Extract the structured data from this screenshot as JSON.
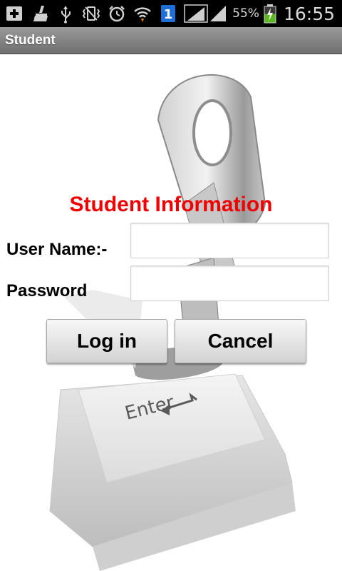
{
  "status_bar": {
    "icons": [
      "add-notification-icon",
      "broom-icon",
      "usb-icon",
      "vibrate-icon",
      "alarm-icon",
      "wifi-icon",
      "sim-1-icon",
      "signal-icon",
      "signal-icon"
    ],
    "sim_number": "1",
    "battery_percent": "55%",
    "time": "16:55"
  },
  "app": {
    "title": "Student"
  },
  "form": {
    "heading": "Student Information",
    "username_label": "User Name:-",
    "password_label": "Password",
    "username_value": "",
    "password_value": "",
    "login_label": "Log in",
    "cancel_label": "Cancel"
  },
  "background": {
    "key_label": "Enter",
    "description_icon": "key-in-enter-key-icon"
  },
  "colors": {
    "heading": "#f00000",
    "title_bar": "#7f7f7f",
    "status_bar": "#000000"
  }
}
